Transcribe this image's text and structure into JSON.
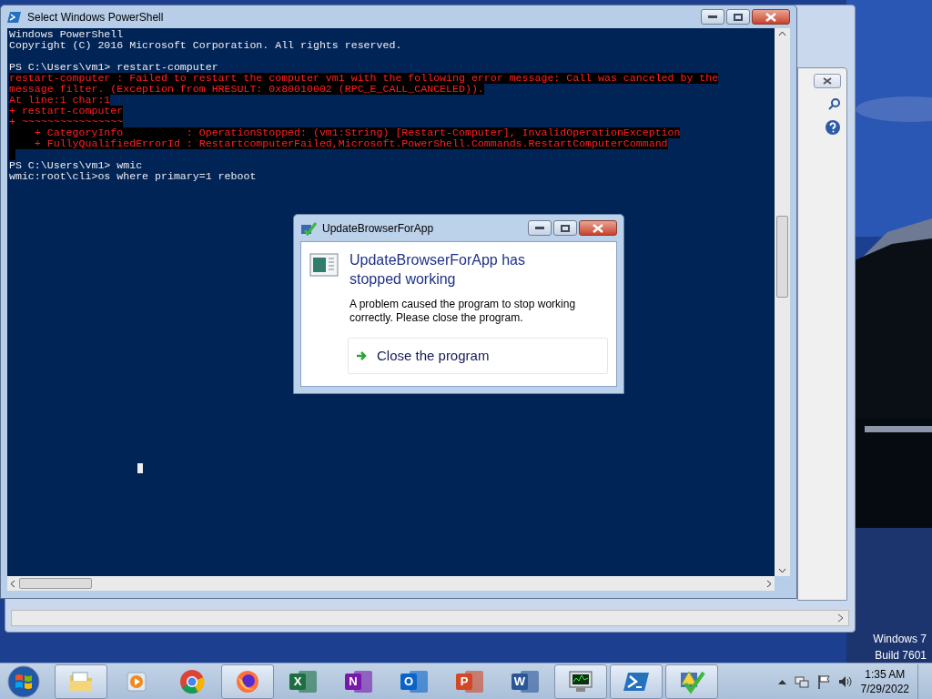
{
  "powershell": {
    "title": "Select Windows PowerShell",
    "lines": [
      {
        "kind": "normal",
        "text": "Windows PowerShell"
      },
      {
        "kind": "normal",
        "text": "Copyright (C) 2016 Microsoft Corporation. All rights reserved."
      },
      {
        "kind": "blank"
      },
      {
        "kind": "normal",
        "text": "PS C:\\Users\\vm1> restart-computer"
      },
      {
        "kind": "error",
        "text": "restart-computer : Failed to restart the computer vm1 with the following error message: Call was canceled by the"
      },
      {
        "kind": "error",
        "text": "message filter. (Exception from HRESULT: 0x80010002 (RPC_E_CALL_CANCELED))."
      },
      {
        "kind": "error",
        "text": "At line:1 char:1"
      },
      {
        "kind": "error",
        "text": "+ restart-computer"
      },
      {
        "kind": "error",
        "text": "+ ~~~~~~~~~~~~~~~~"
      },
      {
        "kind": "error",
        "text": "    + CategoryInfo          : OperationStopped: (vm1:String) [Restart-Computer], InvalidOperationException"
      },
      {
        "kind": "error",
        "text": "    + FullyQualifiedErrorId : RestartcomputerFailed,Microsoft.PowerShell.Commands.RestartComputerCommand"
      },
      {
        "kind": "error_blank"
      },
      {
        "kind": "normal",
        "text": "PS C:\\Users\\vm1> wmic"
      },
      {
        "kind": "normal",
        "text": "wmic:root\\cli>os where primary=1 reboot"
      }
    ]
  },
  "dialog": {
    "title": "UpdateBrowserForApp",
    "heading": "UpdateBrowserForApp has stopped working",
    "message": "A problem caused the program to stop working correctly. Please close the program.",
    "action": "Close the program"
  },
  "desktop": {
    "os_name": "Windows 7",
    "build": "Build 7601"
  },
  "taskbar": {
    "items": [
      {
        "kind": "explorer",
        "running": true
      },
      {
        "kind": "media",
        "running": false
      },
      {
        "kind": "chrome",
        "running": false
      },
      {
        "kind": "firefox",
        "running": true
      },
      {
        "kind": "office",
        "label": "X",
        "color": "#1d6f42",
        "running": false
      },
      {
        "kind": "office",
        "label": "N",
        "color": "#7719aa",
        "running": false
      },
      {
        "kind": "office",
        "label": "O",
        "color": "#0a64c8",
        "running": false
      },
      {
        "kind": "office",
        "label": "P",
        "color": "#d24726",
        "running": false
      },
      {
        "kind": "office",
        "label": "W",
        "color": "#2b5797",
        "running": false
      },
      {
        "kind": "monitor",
        "running": true
      },
      {
        "kind": "powershell",
        "running": true
      },
      {
        "kind": "alert",
        "running": true
      }
    ],
    "time": "1:35 AM",
    "date": "7/29/2022"
  }
}
